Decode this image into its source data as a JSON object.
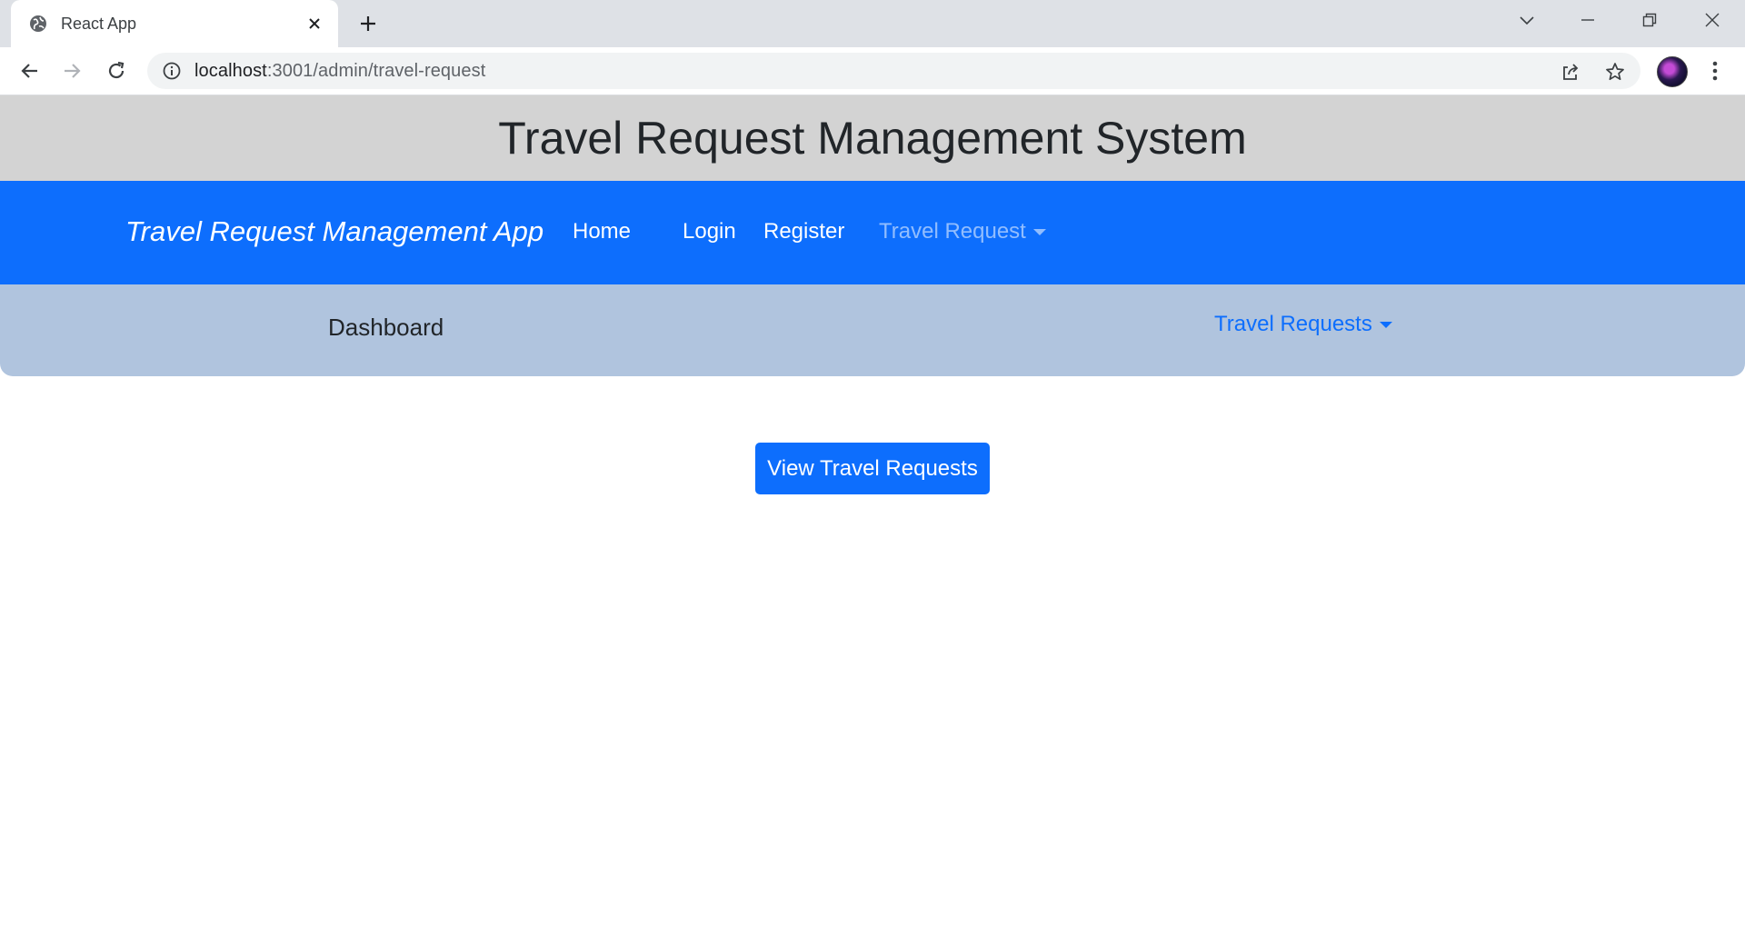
{
  "browser": {
    "tab_title": "React App",
    "url_host": "localhost",
    "url_rest": ":3001/admin/travel-request",
    "icons": [
      "globe-icon",
      "close-icon",
      "plus-icon",
      "chevron-down-icon",
      "minimize-icon",
      "restore-icon",
      "window-close-icon",
      "back-arrow-icon",
      "forward-arrow-icon",
      "reload-icon",
      "info-icon",
      "share-icon",
      "star-icon",
      "avatar",
      "kebab-menu-icon"
    ]
  },
  "header": {
    "title": "Travel Request Management System"
  },
  "navbar": {
    "brand": "Travel Request Management App",
    "links": [
      {
        "label": "Home"
      },
      {
        "label": "Login"
      },
      {
        "label": "Register"
      },
      {
        "label": "Travel Request"
      }
    ],
    "bg_color": "#0d6efd"
  },
  "subnav": {
    "dashboard": "Dashboard",
    "travel_requests": "Travel Requests",
    "bg_color": "#b0c4de"
  },
  "main": {
    "view_button": "View Travel Requests"
  },
  "colors": {
    "header_bg": "#d3d3d3",
    "primary": "#0d6efd"
  }
}
